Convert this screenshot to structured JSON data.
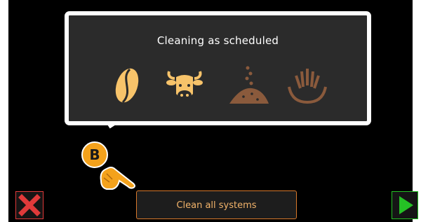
{
  "callout": {
    "title": "Cleaning as scheduled",
    "icons": [
      "coffee-bean-icon",
      "cow-head-icon",
      "powder-icon",
      "brewing-unit-icon"
    ]
  },
  "marker": {
    "label": "B"
  },
  "buttons": {
    "cancel_icon": "close-x-icon",
    "main_label": "Clean all systems",
    "next_icon": "play-arrow-icon"
  },
  "colors": {
    "active_icon": "#f7c36a",
    "inactive_icon": "#8a5a3c",
    "marker": "#f4a21c",
    "main_button_border": "#d8792b",
    "main_button_text": "#f2b36a",
    "cancel": "#e03a3a",
    "next": "#25c025"
  }
}
